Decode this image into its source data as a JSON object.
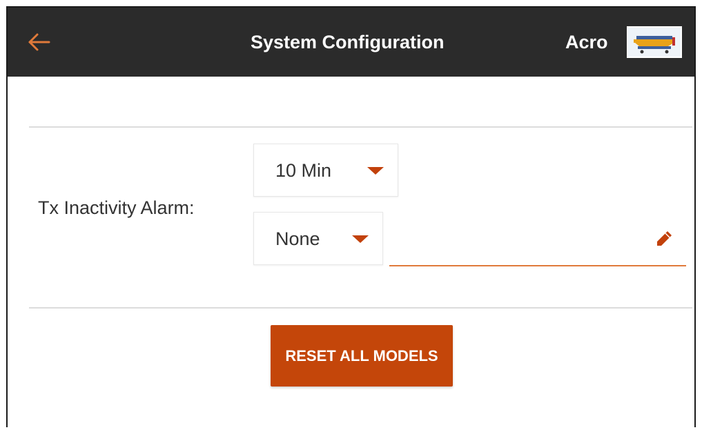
{
  "colors": {
    "header_bg": "#2b2b2b",
    "accent": "#c4460a",
    "accent_light": "#e07a3a",
    "divider": "#dcdcdc",
    "text": "#333333"
  },
  "header": {
    "back_icon": "arrow-left-icon",
    "title": "System Configuration",
    "model_name": "Acro",
    "model_image": "airplane-thumbnail"
  },
  "settings": {
    "inactivity_alarm": {
      "label": "Tx Inactivity Alarm:",
      "time_value": "10 Min",
      "alert_value": "None",
      "caret_icon": "caret-down-icon",
      "text_field_value": "",
      "edit_icon": "pencil-icon"
    }
  },
  "actions": {
    "reset_label": "RESET ALL MODELS"
  }
}
